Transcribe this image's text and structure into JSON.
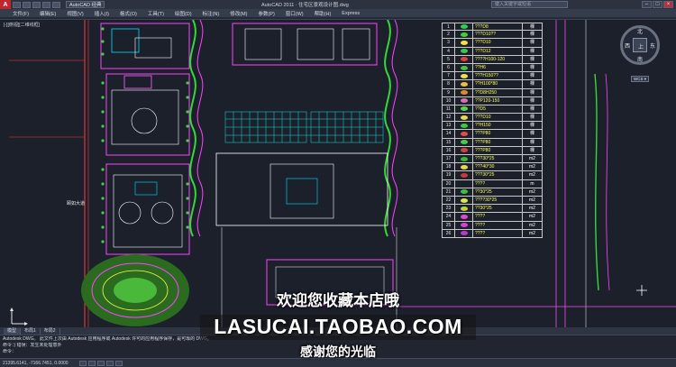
{
  "window": {
    "app_logo": "A",
    "workspace": "AutoCAD 经典",
    "document_title": "AutoCAD 2011  ·  住宅区景观设计图.dwg",
    "search_placeholder": "键入关键字或短语",
    "minimize": "–",
    "maximize": "□",
    "close": "×"
  },
  "menubar": {
    "items": [
      "文件(F)",
      "编辑(E)",
      "视图(V)",
      "插入(I)",
      "格式(O)",
      "工具(T)",
      "绘图(D)",
      "标注(N)",
      "修改(M)",
      "参数(P)",
      "窗口(W)",
      "帮助(H)",
      "Express"
    ]
  },
  "viewport": {
    "label": "[-][俯视][二维线框]"
  },
  "legend": {
    "rows": [
      {
        "num": "1",
        "name": "???D8",
        "unit": "棵",
        "color": "#2fd14a"
      },
      {
        "num": "2",
        "name": "???D10??",
        "unit": "棵",
        "color": "#3fd13a"
      },
      {
        "num": "3",
        "name": "???D10",
        "unit": "棵",
        "color": "#f6e23a"
      },
      {
        "num": "4",
        "name": "???D12",
        "unit": "棵",
        "color": "#34c84c"
      },
      {
        "num": "5",
        "name": "????H100-120",
        "unit": "棵",
        "color": "#e04040"
      },
      {
        "num": "6",
        "name": "??H6",
        "unit": "棵",
        "color": "#41c641"
      },
      {
        "num": "7",
        "name": "???H150??",
        "unit": "棵",
        "color": "#f0e050"
      },
      {
        "num": "8",
        "name": "??H100*80",
        "unit": "棵",
        "color": "#e6c23a"
      },
      {
        "num": "9",
        "name": "??D8H250",
        "unit": "棵",
        "color": "#e08a2a"
      },
      {
        "num": "10",
        "name": "??P120-150",
        "unit": "棵",
        "color": "#d86db8"
      },
      {
        "num": "11",
        "name": "??D5",
        "unit": "棵",
        "color": "#54d654"
      },
      {
        "num": "12",
        "name": "???D10",
        "unit": "棵",
        "color": "#e8d84a"
      },
      {
        "num": "13",
        "name": "??H150",
        "unit": "棵",
        "color": "#3ec83e"
      },
      {
        "num": "14",
        "name": "???P80",
        "unit": "棵",
        "color": "#e64a4a"
      },
      {
        "num": "15",
        "name": "???P80",
        "unit": "棵",
        "color": "#46cc46"
      },
      {
        "num": "16",
        "name": "???P80",
        "unit": "棵",
        "color": "#d24040"
      },
      {
        "num": "17",
        "name": "???30*25",
        "unit": "m2",
        "color": "#2fbf2f"
      },
      {
        "num": "18",
        "name": "???40*30",
        "unit": "m2",
        "color": "#e6d84a"
      },
      {
        "num": "19",
        "name": "???30*25",
        "unit": "m2",
        "color": "#c93a3a"
      },
      {
        "num": "20",
        "name": "????",
        "unit": "m",
        "color": "#1a1f2b"
      },
      {
        "num": "21",
        "name": "??30*25",
        "unit": "m2",
        "color": "#3fbf3f"
      },
      {
        "num": "22",
        "name": "????30*25",
        "unit": "m2",
        "color": "#d9e84a"
      },
      {
        "num": "23",
        "name": "??30*25",
        "unit": "m2",
        "color": "#bcd23f"
      },
      {
        "num": "24",
        "name": "????",
        "unit": "m2",
        "color": "#e04ad0"
      },
      {
        "num": "25",
        "name": "????",
        "unit": "m2",
        "color": "#d93fd9"
      },
      {
        "num": "26",
        "name": "????",
        "unit": "m2",
        "color": "#b83ad0"
      }
    ]
  },
  "compass": {
    "north": "北",
    "south": "南",
    "west": "西",
    "east": "东",
    "top": "上",
    "wcs": "WCS ▾"
  },
  "drawing_texts": {
    "road_label": "颐如大道"
  },
  "layout_tabs": [
    "模型",
    "布局1",
    "布局2"
  ],
  "command": {
    "lines": [
      "Autodesk DWG。 此文件上次由 Autodesk 应用程序或 Autodesk 许可的应用程序保存，是可靠的 DWG。",
      "命令：) 错误：发生未处理意外",
      "命令："
    ]
  },
  "status": {
    "coords": "21395.6141, -7166.7451, 0.0000"
  },
  "watermark": {
    "line1": "欢迎您收藏本店哦",
    "line2": "LASUCAI.TAOBAO.COM",
    "line3": "感谢您的光临"
  }
}
